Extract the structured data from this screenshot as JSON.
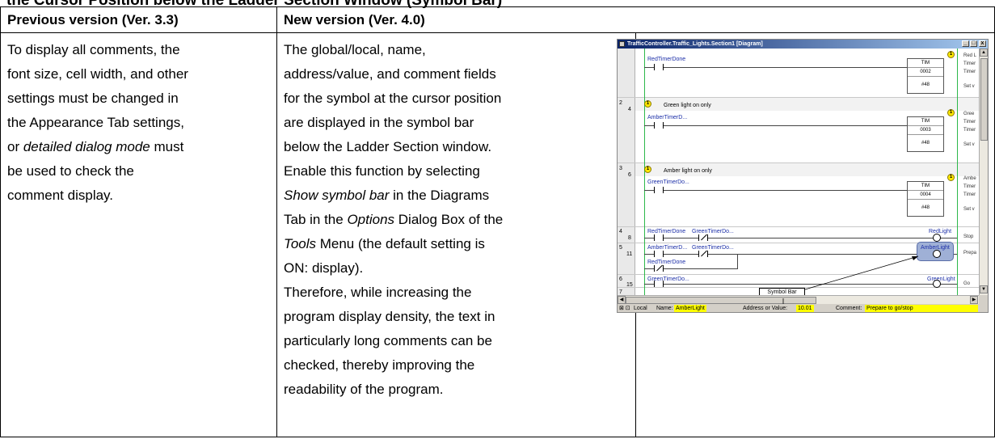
{
  "heading": "the Cursor Position below the Ladder Section Window (Symbol Bar)",
  "table": {
    "header_prev": "Previous version (Ver. 3.3)",
    "header_new": "New version (Ver. 4.0)",
    "prev_text": {
      "line1": "To display all comments, the",
      "line2": "font size, cell width, and other",
      "line3": "settings must be changed in",
      "line4": "the Appearance Tab settings,",
      "line5_pre": "or ",
      "line5_em": "detailed dialog mode",
      "line5_post": " must",
      "line6": "be used to check the",
      "line7": "comment display."
    },
    "new_text": {
      "line1": "The global/local, name,",
      "line2": "address/value, and comment fields",
      "line3": "for the symbol at the cursor position",
      "line4": "are displayed in the symbol bar",
      "line5": "below the Ladder Section window.",
      "line6": "Enable this function by selecting",
      "line7_em": "Show symbol bar",
      "line7_post": " in the Diagrams",
      "line8_pre": "Tab in the ",
      "line8_em": "Options",
      "line8_post": " Dialog Box of the",
      "line9_em": "Tools",
      "line9_post": " Menu (the default setting is",
      "line10": "ON: display).",
      "line11": "Therefore, while increasing the",
      "line12": "program display density, the text in",
      "line13": "particularly long comments can be",
      "line14": "checked, thereby improving the",
      "line15": "readability of the program."
    }
  },
  "screenshot": {
    "window_title": "TrafficController.Traffic_Lights.Section1 [Diagram]",
    "btn_min": "_",
    "btn_max": "□",
    "btn_close": "x",
    "icon_num": "1",
    "rungs": {
      "r1": {
        "contact": "RedTimerDone",
        "block_op": "TIM",
        "block_num": "0002",
        "block_set": "#48",
        "out1": "Red L",
        "out2": "Timer",
        "out3": "Timer",
        "out4": "Set v"
      },
      "r2": {
        "rung": "2",
        "step": "4",
        "comment": "Green light on only",
        "contact": "AmberTimerD...",
        "block_op": "TIM",
        "block_num": "0003",
        "block_set": "#48",
        "out1": "Gree",
        "out2": "Timer",
        "out3": "Timer",
        "out4": "Set v"
      },
      "r3": {
        "rung": "3",
        "step": "6",
        "comment": "Amber light on only",
        "contact": "GreenTimerDo...",
        "block_op": "TIM",
        "block_num": "0004",
        "block_set": "#48",
        "out1": "Ambe",
        "out2": "Timer",
        "out3": "Timer",
        "out4": "Set v"
      },
      "r4": {
        "rung": "4",
        "step": "8",
        "c1": "RedTimerDone",
        "c2": "GreenTimerDo...",
        "coil": "RedLight",
        "out": "Stop"
      },
      "r5": {
        "rung": "5",
        "step": "11",
        "c1": "AmberTimerD...",
        "c2": "GreenTimerDo...",
        "c3": "RedTimerDone",
        "coil": "AmberLight",
        "out": "Prepa"
      },
      "r6": {
        "rung": "6",
        "step": "15",
        "c1": "GreenTimerDo...",
        "coil": "GreenLight",
        "out": "Go"
      },
      "r7": {
        "rung": "7"
      }
    },
    "callout": "Symbol Bar",
    "scroll_up": "▲",
    "scroll_down": "▼",
    "scroll_left": "◀",
    "scroll_right": "▶",
    "status": {
      "nav_icons": "⊠ ⊡",
      "scope": "Local",
      "name_label": "Name:",
      "name_value": "AmberLight",
      "addr_label": "Address or Value:",
      "addr_value": "10.01",
      "comment_label": "Comment:",
      "comment_value": "Prepare to go/stop"
    }
  }
}
